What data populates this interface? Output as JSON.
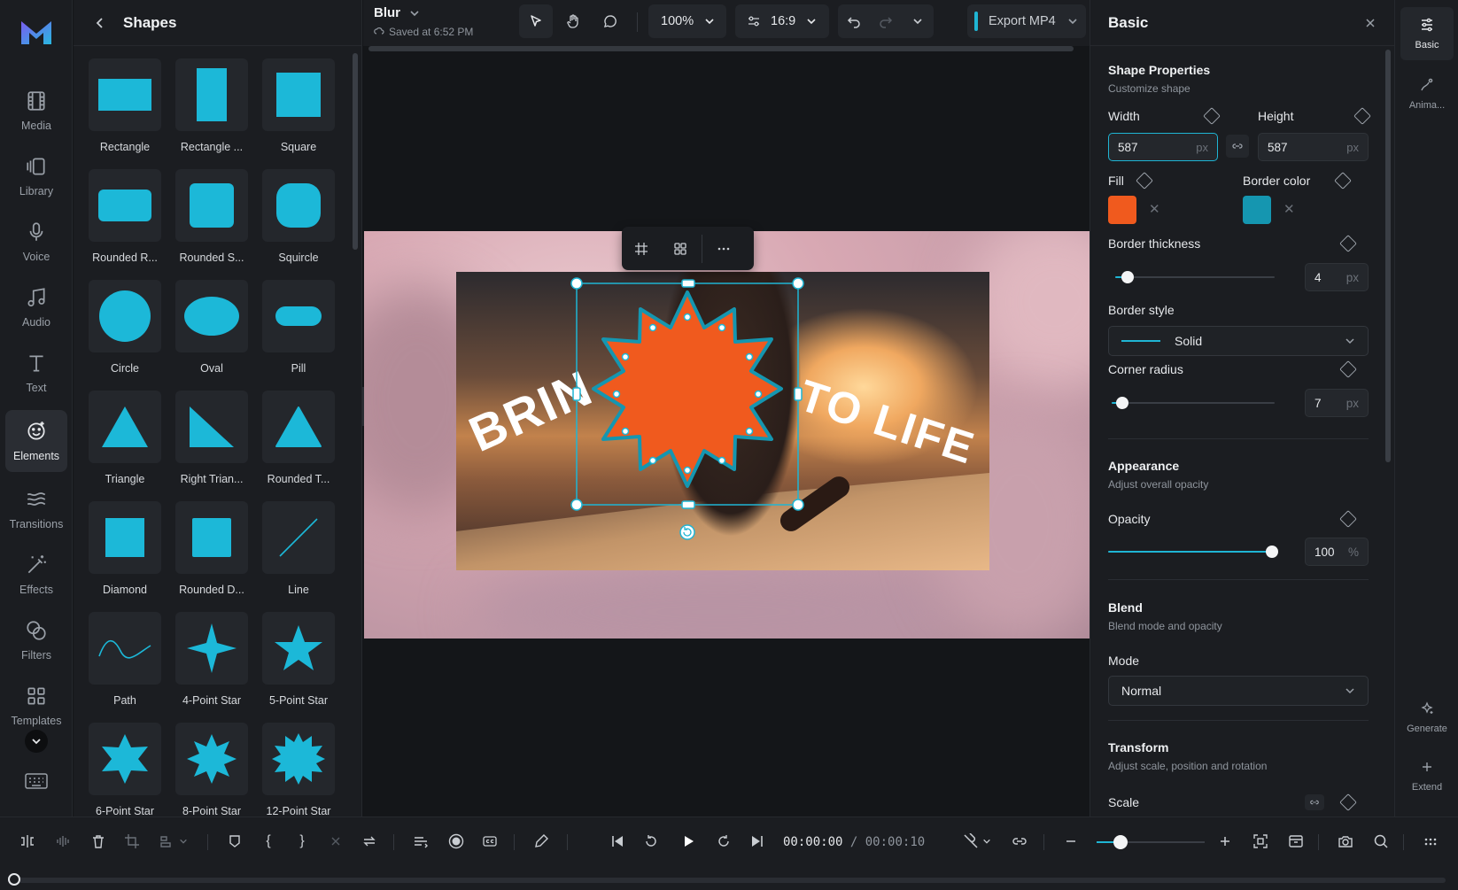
{
  "rail": {
    "items": [
      {
        "label": "Media",
        "icon": "film-icon"
      },
      {
        "label": "Library",
        "icon": "library-icon"
      },
      {
        "label": "Voice",
        "icon": "microphone-icon"
      },
      {
        "label": "Audio",
        "icon": "music-note-icon"
      },
      {
        "label": "Text",
        "icon": "text-icon"
      },
      {
        "label": "Elements",
        "icon": "elements-icon",
        "active": true
      },
      {
        "label": "Transitions",
        "icon": "transitions-icon"
      },
      {
        "label": "Effects",
        "icon": "magic-wand-icon"
      },
      {
        "label": "Filters",
        "icon": "filters-icon"
      },
      {
        "label": "Templates",
        "icon": "templates-icon"
      }
    ]
  },
  "shapes_panel": {
    "title": "Shapes",
    "tiles": [
      {
        "label": "Rectangle",
        "shape": "rect"
      },
      {
        "label": "Rectangle ...",
        "shape": "rect-tall"
      },
      {
        "label": "Square",
        "shape": "square"
      },
      {
        "label": "Rounded R...",
        "shape": "rounded-rect"
      },
      {
        "label": "Rounded S...",
        "shape": "rounded-square"
      },
      {
        "label": "Squircle",
        "shape": "squircle"
      },
      {
        "label": "Circle",
        "shape": "circle"
      },
      {
        "label": "Oval",
        "shape": "oval"
      },
      {
        "label": "Pill",
        "shape": "pill"
      },
      {
        "label": "Triangle",
        "shape": "triangle"
      },
      {
        "label": "Right Trian...",
        "shape": "right-triangle"
      },
      {
        "label": "Rounded T...",
        "shape": "rounded-triangle"
      },
      {
        "label": "Diamond",
        "shape": "diamond"
      },
      {
        "label": "Rounded D...",
        "shape": "rounded-diamond"
      },
      {
        "label": "Line",
        "shape": "line"
      },
      {
        "label": "Path",
        "shape": "path"
      },
      {
        "label": "4-Point Star",
        "shape": "star4"
      },
      {
        "label": "5-Point Star",
        "shape": "star5"
      },
      {
        "label": "6-Point Star",
        "shape": "star6"
      },
      {
        "label": "8-Point Star",
        "shape": "star8"
      },
      {
        "label": "12-Point Star",
        "shape": "star12"
      }
    ]
  },
  "topbar": {
    "project_name": "Blur",
    "saved_text": "Saved at 6:52 PM",
    "zoom": "100%",
    "aspect": "16:9",
    "export_label": "Export MP4"
  },
  "canvas": {
    "headline_left": "BRIN",
    "headline_right": "TO LIFE"
  },
  "right_panel": {
    "title": "Basic",
    "shape_properties": {
      "title": "Shape Properties",
      "subtitle": "Customize shape"
    },
    "width": {
      "label": "Width",
      "value": "587",
      "unit": "px"
    },
    "height": {
      "label": "Height",
      "value": "587",
      "unit": "px"
    },
    "fill": {
      "label": "Fill",
      "color": "#f05a1e"
    },
    "border_color": {
      "label": "Border color",
      "color": "#1596b0"
    },
    "border_thickness": {
      "label": "Border thickness",
      "value": "4",
      "unit": "px",
      "level": 0.04
    },
    "border_style": {
      "label": "Border style",
      "value": "Solid"
    },
    "corner_radius": {
      "label": "Corner radius",
      "value": "7",
      "unit": "px",
      "level": 0.03
    },
    "appearance": {
      "title": "Appearance",
      "subtitle": "Adjust overall opacity"
    },
    "opacity": {
      "label": "Opacity",
      "value": "100",
      "unit": "%",
      "level": 1.0
    },
    "blend": {
      "title": "Blend",
      "subtitle": "Blend mode and opacity"
    },
    "mode": {
      "label": "Mode",
      "value": "Normal"
    },
    "transform": {
      "title": "Transform",
      "subtitle": "Adjust scale, position and rotation"
    },
    "scale": {
      "label": "Scale"
    }
  },
  "strip": {
    "basic": "Basic",
    "animate": "Anima...",
    "generate": "Generate",
    "extend": "Extend"
  },
  "bottom": {
    "time_current": "00:00:00",
    "time_separator": "/",
    "time_total": "00:00:10"
  },
  "colors": {
    "accent": "#1fb5d4",
    "shape_fill": "#f05a1e",
    "shape_tile": "#1cb8d8"
  }
}
